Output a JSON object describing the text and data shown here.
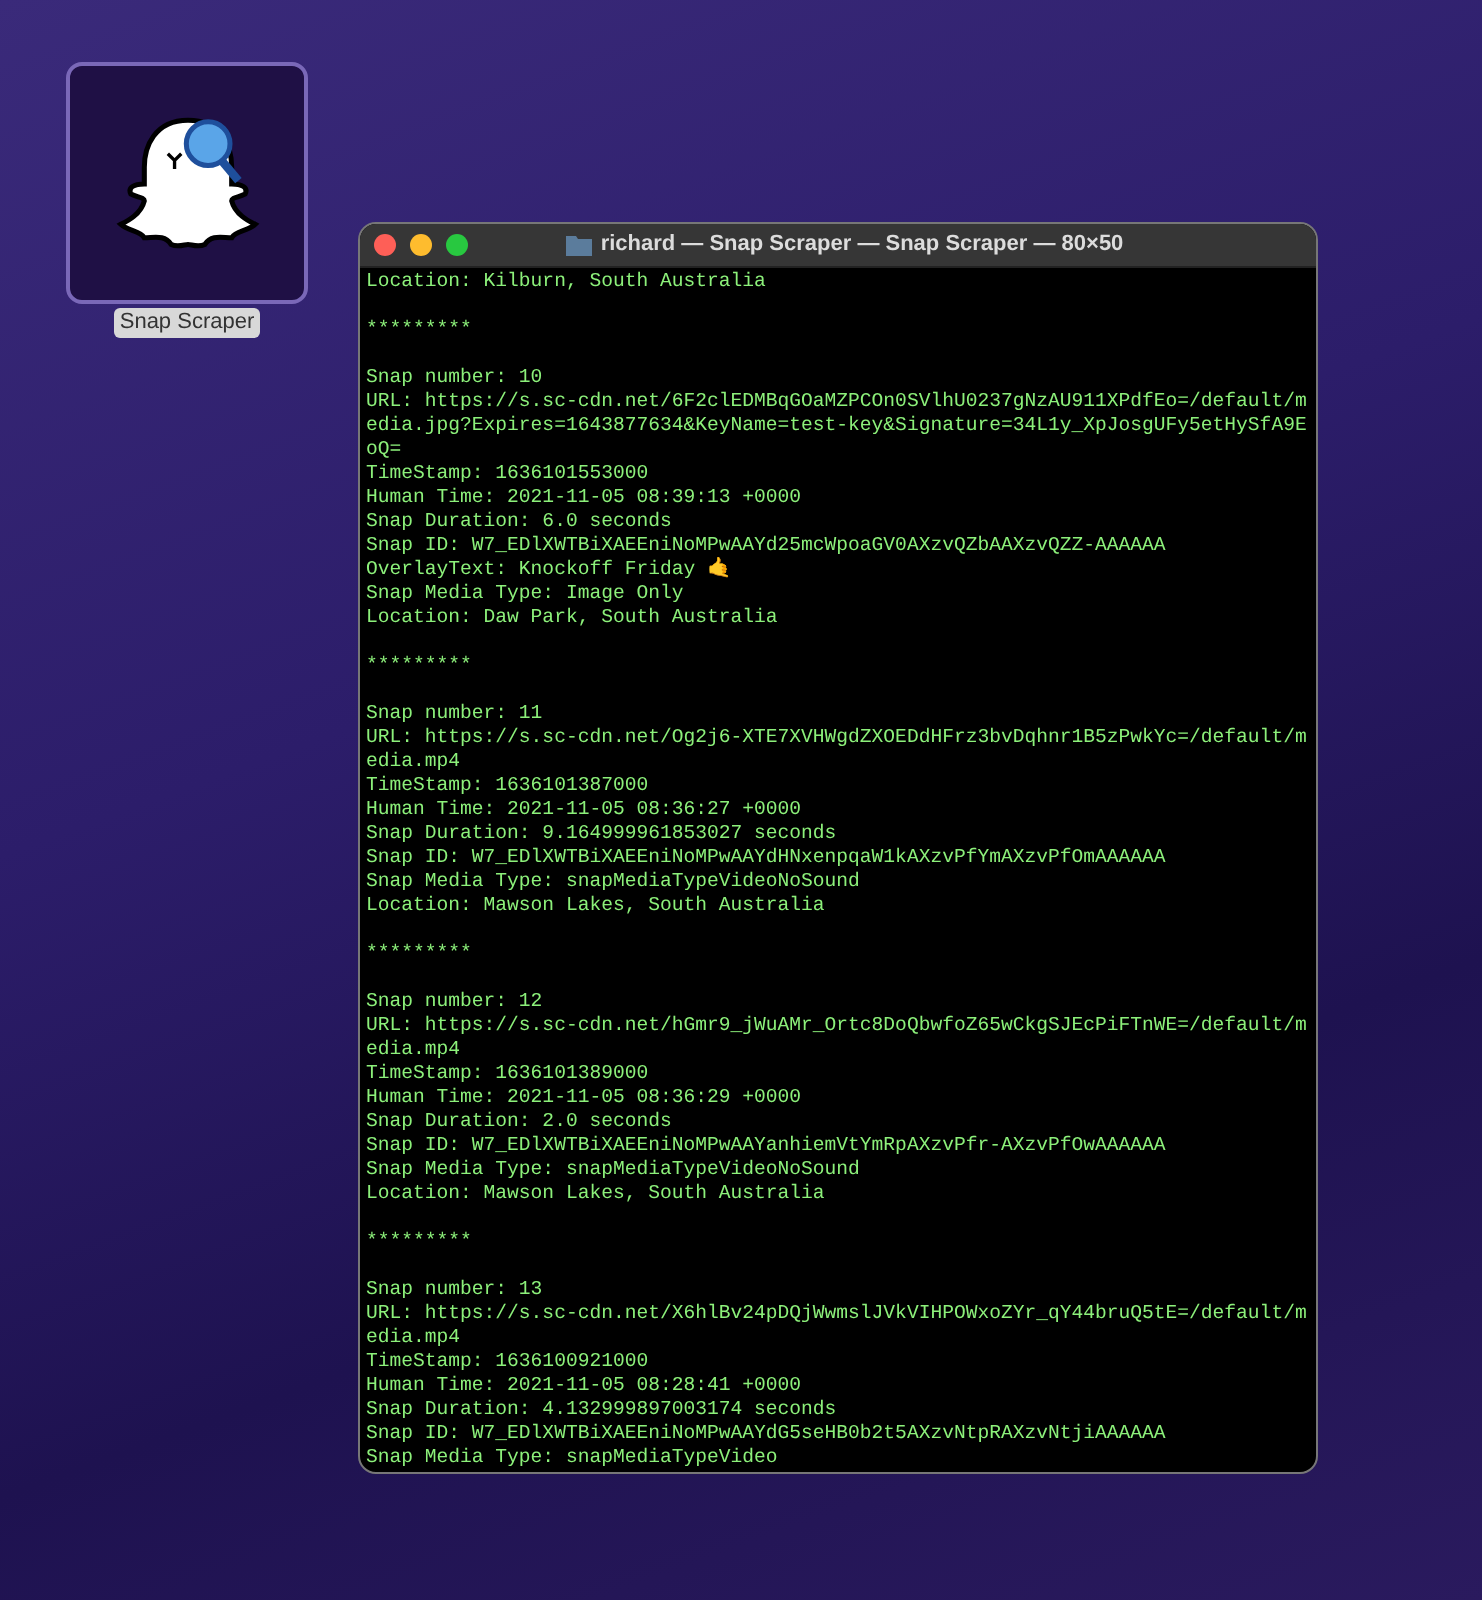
{
  "desktop_icon": {
    "label": "Snap Scraper",
    "selected": true
  },
  "window": {
    "title": "richard — Snap Scraper — Snap Scraper — 80×50"
  },
  "output": [
    {
      "kind": "line",
      "text": "Location: Kilburn, South Australia"
    },
    {
      "kind": "blank"
    },
    {
      "kind": "line",
      "text": "*********"
    },
    {
      "kind": "blank"
    },
    {
      "kind": "line",
      "text": "Snap number: 10"
    },
    {
      "kind": "line",
      "text": "URL: https://s.sc-cdn.net/6F2clEDMBqGOaMZPCOn0SVlhU0237gNzAU911XPdfEo=/default/m"
    },
    {
      "kind": "line",
      "text": "edia.jpg?Expires=1643877634&KeyName=test-key&Signature=34L1y_XpJosgUFy5etHySfA9E"
    },
    {
      "kind": "line",
      "text": "oQ="
    },
    {
      "kind": "line",
      "text": "TimeStamp: 1636101553000"
    },
    {
      "kind": "line",
      "text": "Human Time: 2021-11-05 08:39:13 +0000"
    },
    {
      "kind": "line",
      "text": "Snap Duration: 6.0 seconds"
    },
    {
      "kind": "line",
      "text": "Snap ID: W7_EDlXWTBiXAEEniNoMPwAAYd25mcWpoaGV0AXzvQZbAAXzvQZZ-AAAAAA"
    },
    {
      "kind": "line",
      "text": "OverlayText: Knockoff Friday 🤙"
    },
    {
      "kind": "line",
      "text": "Snap Media Type: Image Only"
    },
    {
      "kind": "line",
      "text": "Location: Daw Park, South Australia"
    },
    {
      "kind": "blank"
    },
    {
      "kind": "line",
      "text": "*********"
    },
    {
      "kind": "blank"
    },
    {
      "kind": "line",
      "text": "Snap number: 11"
    },
    {
      "kind": "line",
      "text": "URL: https://s.sc-cdn.net/Og2j6-XTE7XVHWgdZXOEDdHFrz3bvDqhnr1B5zPwkYc=/default/m"
    },
    {
      "kind": "line",
      "text": "edia.mp4"
    },
    {
      "kind": "line",
      "text": "TimeStamp: 1636101387000"
    },
    {
      "kind": "line",
      "text": "Human Time: 2021-11-05 08:36:27 +0000"
    },
    {
      "kind": "line",
      "text": "Snap Duration: 9.164999961853027 seconds"
    },
    {
      "kind": "line",
      "text": "Snap ID: W7_EDlXWTBiXAEEniNoMPwAAYdHNxenpqaW1kAXzvPfYmAXzvPfOmAAAAAA"
    },
    {
      "kind": "line",
      "text": "Snap Media Type: snapMediaTypeVideoNoSound"
    },
    {
      "kind": "line",
      "text": "Location: Mawson Lakes, South Australia"
    },
    {
      "kind": "blank"
    },
    {
      "kind": "line",
      "text": "*********"
    },
    {
      "kind": "blank"
    },
    {
      "kind": "line",
      "text": "Snap number: 12"
    },
    {
      "kind": "line",
      "text": "URL: https://s.sc-cdn.net/hGmr9_jWuAMr_Ortc8DoQbwfoZ65wCkgSJEcPiFTnWE=/default/m"
    },
    {
      "kind": "line",
      "text": "edia.mp4"
    },
    {
      "kind": "line",
      "text": "TimeStamp: 1636101389000"
    },
    {
      "kind": "line",
      "text": "Human Time: 2021-11-05 08:36:29 +0000"
    },
    {
      "kind": "line",
      "text": "Snap Duration: 2.0 seconds"
    },
    {
      "kind": "line",
      "text": "Snap ID: W7_EDlXWTBiXAEEniNoMPwAAYanhiemVtYmRpAXzvPfr-AXzvPfOwAAAAAA"
    },
    {
      "kind": "line",
      "text": "Snap Media Type: snapMediaTypeVideoNoSound"
    },
    {
      "kind": "line",
      "text": "Location: Mawson Lakes, South Australia"
    },
    {
      "kind": "blank"
    },
    {
      "kind": "line",
      "text": "*********"
    },
    {
      "kind": "blank"
    },
    {
      "kind": "line",
      "text": "Snap number: 13"
    },
    {
      "kind": "line",
      "text": "URL: https://s.sc-cdn.net/X6hlBv24pDQjWwmslJVkVIHPOWxoZYr_qY44bruQ5tE=/default/m"
    },
    {
      "kind": "line",
      "text": "edia.mp4"
    },
    {
      "kind": "line",
      "text": "TimeStamp: 1636100921000"
    },
    {
      "kind": "line",
      "text": "Human Time: 2021-11-05 08:28:41 +0000"
    },
    {
      "kind": "line",
      "text": "Snap Duration: 4.132999897003174 seconds"
    },
    {
      "kind": "line",
      "text": "Snap ID: W7_EDlXWTBiXAEEniNoMPwAAYdG5seHB0b2t5AXzvNtpRAXzvNtjiAAAAAA"
    },
    {
      "kind": "line",
      "text": "Snap Media Type: snapMediaTypeVideo"
    }
  ]
}
